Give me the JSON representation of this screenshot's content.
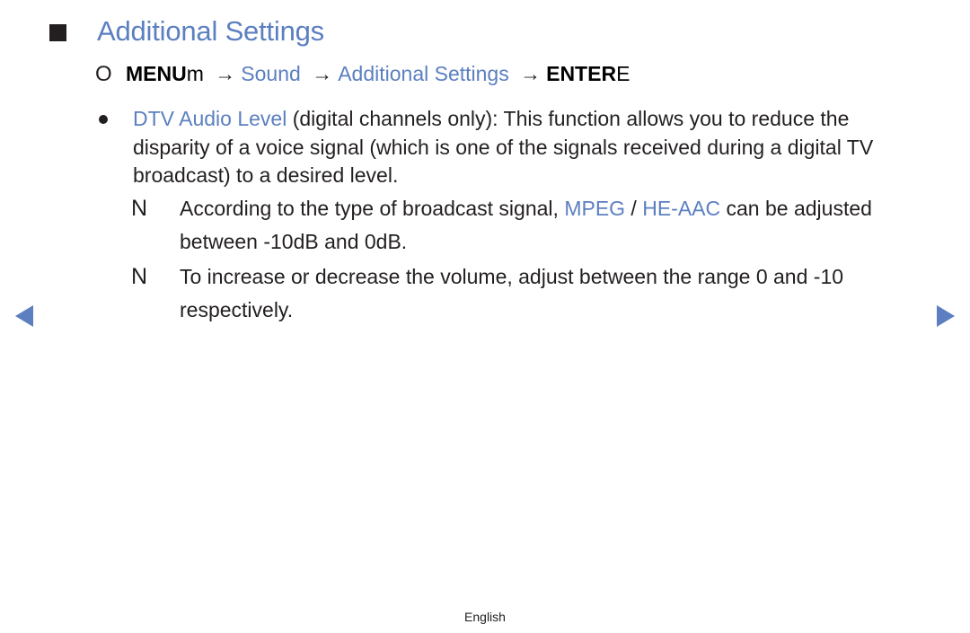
{
  "page": {
    "title": "Additional Settings",
    "title_icon": "square-bullet-icon",
    "menu_path": {
      "prefix_icon_glyph": "O",
      "menu_label": "MENU",
      "menu_glyph": "m",
      "arrow": "→",
      "steps": [
        "Sound",
        "Additional Settings"
      ],
      "enter_label": "ENTER",
      "enter_glyph": "E"
    },
    "bullets": [
      {
        "term": "DTV Audio Level",
        "text": " (digital channels only): This function allows you to reduce the disparity of a voice signal (which is one of the signals received during a digital TV broadcast) to a desired level."
      }
    ],
    "notes": [
      {
        "mark": "N",
        "text_before": "According to the type of broadcast signal, ",
        "term1": "MPEG",
        "separator": " / ",
        "term2": "HE-AAC",
        "text_after": " can be adjusted between -10dB and 0dB."
      },
      {
        "mark": "N",
        "text": "To increase or decrease the volume, adjust between the range 0 and -10 respectively."
      }
    ],
    "nav": {
      "prev_icon": "triangle-left-icon",
      "next_icon": "triangle-right-icon"
    },
    "footer": {
      "language": "English"
    }
  },
  "colors": {
    "accent": "#5b7fc0",
    "text": "#231f20"
  }
}
